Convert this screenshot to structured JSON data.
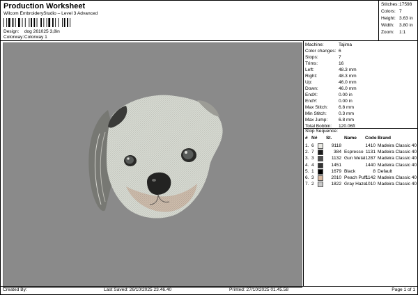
{
  "header": {
    "title": "Production Worksheet",
    "subtitle": "Wilcom EmbroideryStudio – Level 3 Advanced",
    "design_label": "Design:",
    "design_value": "dog 261025 3,8in",
    "colorway_label": "Colorway:",
    "colorway_value": "Colorway 1"
  },
  "stats": {
    "stitches_label": "Stitches:",
    "stitches_value": "17598",
    "colors_label": "Colors:",
    "colors_value": "7",
    "height_label": "Height:",
    "height_value": "3.63 in",
    "width_label": "Width:",
    "width_value": "3.80 in",
    "zoom_label": "Zoom:",
    "zoom_value": "1:1"
  },
  "machine": [
    {
      "label": "Machine:",
      "value": "Tajima"
    },
    {
      "label": "Color changes:",
      "value": "6"
    },
    {
      "label": "Stops:",
      "value": "7"
    },
    {
      "label": "Trims:",
      "value": "16"
    },
    {
      "label": "Left:",
      "value": "48.3 mm"
    },
    {
      "label": "Right:",
      "value": "48.3 mm"
    },
    {
      "label": "Up:",
      "value": "46.0 mm"
    },
    {
      "label": "Down:",
      "value": "46.0 mm"
    },
    {
      "label": "EndX:",
      "value": "0.00 in"
    },
    {
      "label": "EndY:",
      "value": "0.00 in"
    },
    {
      "label": "Max Stitch:",
      "value": "6.8 mm"
    },
    {
      "label": "Min Stitch:",
      "value": "0.3 mm"
    },
    {
      "label": "Max Jump:",
      "value": "6.8 mm"
    },
    {
      "label": "Total Bobbin:",
      "value": "120.06ft"
    }
  ],
  "sequence": {
    "title": "Stop Sequence:",
    "headers": {
      "num": "#",
      "n": "N#",
      "st": "St.",
      "name": "Name",
      "code": "Code",
      "brand": "Brand"
    },
    "rows": [
      {
        "num": "1.",
        "n": "6",
        "st": "9118",
        "name": "",
        "code": "1410",
        "brand": "Madeira Classic 40",
        "color": "#e9e9e3"
      },
      {
        "num": "2.",
        "n": "7",
        "st": "384",
        "name": "Espresso",
        "code": "1131",
        "brand": "Madeira Classic 40",
        "color": "#1d1d1d"
      },
      {
        "num": "3.",
        "n": "3",
        "st": "1132",
        "name": "Gun Metal",
        "code": "1287",
        "brand": "Madeira Classic 40",
        "color": "#4f4f4f"
      },
      {
        "num": "4.",
        "n": "4",
        "st": "1451",
        "name": "",
        "code": "1440",
        "brand": "Madeira Classic 40",
        "color": "#333333"
      },
      {
        "num": "5.",
        "n": "1",
        "st": "1679",
        "name": "Black",
        "code": "8",
        "brand": "Default",
        "color": "#000000"
      },
      {
        "num": "6.",
        "n": "3",
        "st": "2010",
        "name": "Peach Puff",
        "code": "1142",
        "brand": "Madeira Classic 40",
        "color": "#d7b8a0"
      },
      {
        "num": "7.",
        "n": "2",
        "st": "1822",
        "name": "Gray Haze",
        "code": "1010",
        "brand": "Madeira Classic 40",
        "color": "#c9c9c9"
      }
    ]
  },
  "footer": {
    "created_by": "Created By:",
    "last_saved": "Last Saved: 26/10/2025 23.46.40",
    "printed": "Printed: 27/10/2025 01.45.58",
    "page": "Page 1 of 1"
  },
  "colors": {
    "canvas": "#8a8a8a"
  },
  "design_image": "embroidered dog face"
}
